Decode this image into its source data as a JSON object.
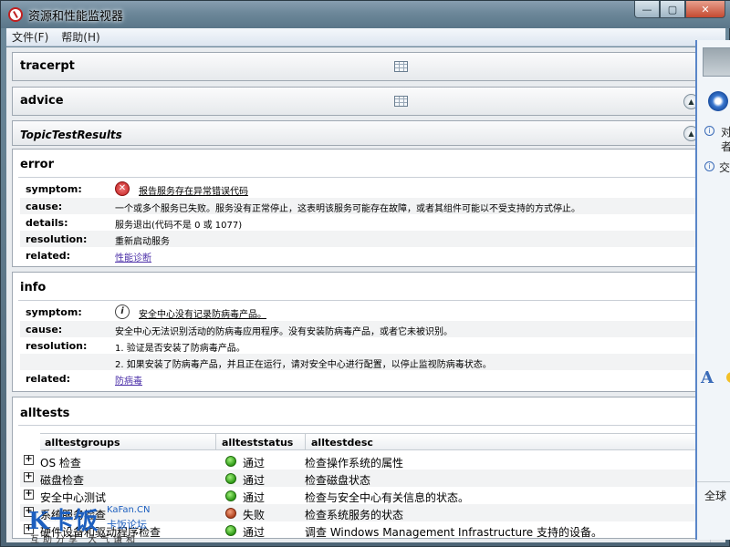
{
  "window": {
    "title": "资源和性能监视器",
    "controls": {
      "minimize": "—",
      "maximize": "▢",
      "close": "✕"
    }
  },
  "menu": {
    "file": "文件(F)",
    "help": "帮助(H)"
  },
  "bands": {
    "tracerpt": "tracerpt",
    "advice": "advice",
    "topic": "TopicTestResults"
  },
  "error": {
    "title": "error",
    "rows": [
      {
        "label": "symptom:",
        "value": "报告服务存在异常错误代码"
      },
      {
        "label": "cause:",
        "value": "一个或多个服务已失败。服务没有正常停止，这表明该服务可能存在故障，或者其组件可能以不受支持的方式停止。"
      },
      {
        "label": "details:",
        "value": "服务退出(代码不是 0 或 1077)"
      },
      {
        "label": "resolution:",
        "value": "重新启动服务"
      },
      {
        "label": "related:",
        "value": "性能诊断"
      }
    ]
  },
  "info": {
    "title": "info",
    "rows": [
      {
        "label": "symptom:",
        "value": "安全中心没有记录防病毒产品。"
      },
      {
        "label": "cause:",
        "value": "安全中心无法识别活动的防病毒应用程序。没有安装防病毒产品，或者它未被识别。"
      },
      {
        "label": "resolution:",
        "value": "1. 验证是否安装了防病毒产品。"
      },
      {
        "label": "",
        "value": "2. 如果安装了防病毒产品，并且正在运行，请对安全中心进行配置，以停止监视防病毒状态。"
      },
      {
        "label": "related:",
        "value": "防病毒"
      }
    ]
  },
  "alltests": {
    "title": "alltests",
    "columns": [
      "alltestgroups",
      "allteststatus",
      "alltestdesc"
    ],
    "rows": [
      {
        "group": "OS 检查",
        "status": "通过",
        "desc": "检查操作系统的属性"
      },
      {
        "group": "磁盘检查",
        "status": "通过",
        "desc": "检查磁盘状态"
      },
      {
        "group": "安全中心测试",
        "status": "通过",
        "desc": "检查与安全中心有关信息的状态。"
      },
      {
        "group": "系统服务检查",
        "status": "失败",
        "desc": "检查系统服务的状态"
      },
      {
        "group": "硬件设备和驱动程序检查",
        "status": "通过",
        "desc": "调查 Windows Management Infrastructure 支持的设备。"
      }
    ]
  },
  "side_app": {
    "line1": "对",
    "line2": "者",
    "line3": "交",
    "bottom": "全球",
    "font_icon": "A"
  },
  "watermark": {
    "logo": "K卡饭",
    "site": "KaFan.CN",
    "name": "卡饭论坛",
    "slogan": "互助分享  大气谦和"
  },
  "colors": {
    "link": "#4b2fa8",
    "pass": "#2f9a17",
    "fail": "#b0411d",
    "error_icon": "#c21b1b"
  }
}
